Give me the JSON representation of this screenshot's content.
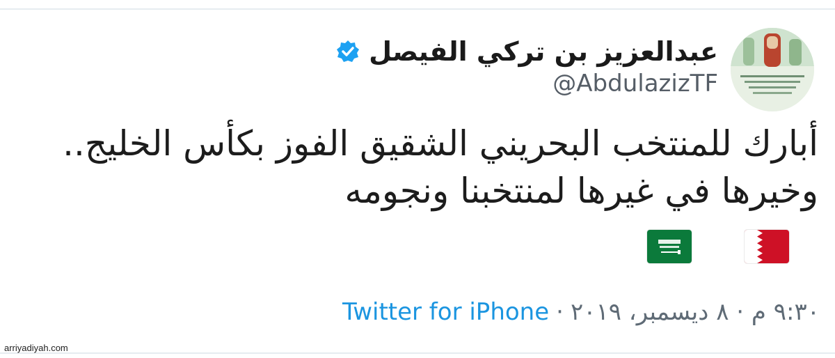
{
  "tweet": {
    "author": {
      "display_name": "عبدالعزيز بن تركي الفيصل",
      "handle": "@AbdulazizTF",
      "verified": true,
      "avatar_icon": "profile-avatar"
    },
    "text_lines": [
      "أبارك للمنتخب البحريني الشقيق الفوز بكأس الخليج..",
      "وخيرها في غيرها لمنتخبنا ونجومه"
    ],
    "flags": [
      {
        "name": "saudi-flag-emoji",
        "color": "#0b7a3b"
      },
      {
        "name": "bahrain-flag-emoji",
        "color": "#ce1126"
      }
    ],
    "timestamp": "٩:٣٠ م · ٨ ديسمبر، ٢٠١٩",
    "separator": "·",
    "source": "Twitter for iPhone"
  },
  "watermark": "arriyadiyah.com",
  "colors": {
    "link": "#1b95e0",
    "verified": "#1da1f2",
    "muted": "#5f6b76"
  }
}
